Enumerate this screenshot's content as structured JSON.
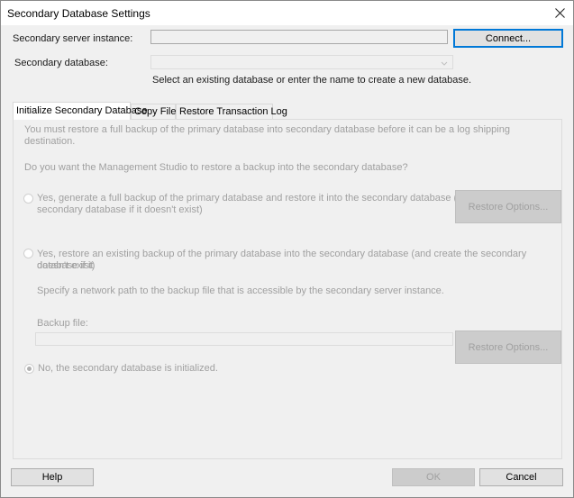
{
  "window": {
    "title": "Secondary Database Settings",
    "close_icon": "close-x-icon"
  },
  "form": {
    "server_label": "Secondary server instance:",
    "server_value": "",
    "connect_label": "Connect...",
    "database_label": "Secondary database:",
    "database_value": "",
    "database_hint": "Select an existing database or enter the name to create a new database."
  },
  "tabs": [
    {
      "label": "Initialize Secondary Database",
      "active": true
    },
    {
      "label": "Copy Files",
      "active": false
    },
    {
      "label": "Restore Transaction Log",
      "active": false
    }
  ],
  "panel": {
    "intro": "You must restore a full backup of the primary database into secondary database before it can be a log shipping destination.",
    "question": "Do you want the Management Studio to restore a backup into the secondary database?",
    "option1_line1": "Yes, generate a full backup of the primary database and restore it into the secondary database (and create the",
    "option1_line2": "secondary database if it doesn't exist)",
    "option2_line1": "Yes, restore an existing backup of the primary database into the secondary database (and create the secondary database if it",
    "option2_line2": "doesn't exist)",
    "network_hint": "Specify a network path to the backup file that is accessible by the secondary server instance.",
    "backup_label": "Backup file:",
    "backup_value": "",
    "restore_options_label": "Restore Options...",
    "option3": "No, the secondary database is initialized.",
    "selected_option": 3
  },
  "footer": {
    "help_label": "Help",
    "ok_label": "OK",
    "cancel_label": "Cancel"
  }
}
